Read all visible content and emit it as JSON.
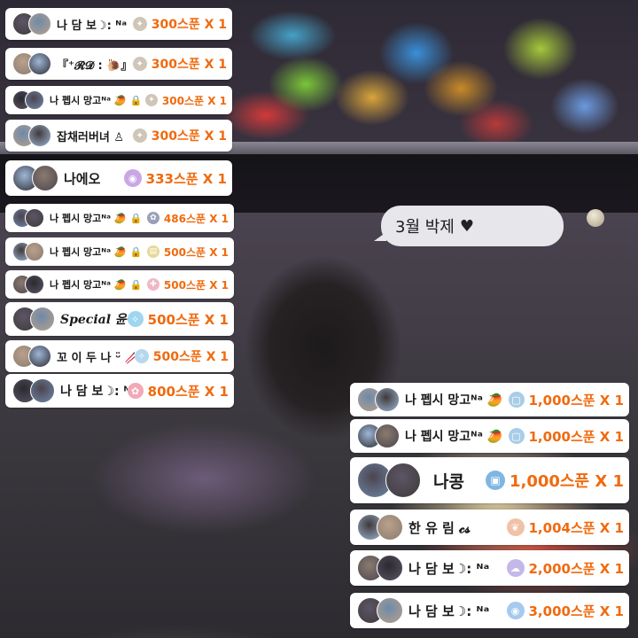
{
  "bubble": {
    "text": "3월 박제",
    "icon": "heart-icon",
    "glyph": "♥"
  },
  "donations": [
    {
      "name": "나 담 보☽: ᴺᵃ",
      "gift_icon": "candle-icon",
      "gift_glyph": "✦",
      "gift_color": "#cfc6b8",
      "amount": "300스푼 X 1"
    },
    {
      "name": "『⁺𝓡𝓓 : 🐌』",
      "gift_icon": "candle-icon",
      "gift_glyph": "✦",
      "gift_color": "#cfc6b8",
      "amount": "300스푼 X 1"
    },
    {
      "name": "나 펩시 망고ᴺᵃ 🥭 🔒",
      "gift_icon": "candle-icon",
      "gift_glyph": "✦",
      "gift_color": "#cfc6b8",
      "amount": "300스푼 X 1"
    },
    {
      "name": "잡채러버녀 ♙",
      "gift_icon": "candle-icon",
      "gift_glyph": "✦",
      "gift_color": "#cfc6b8",
      "amount": "300스푼 X 1"
    },
    {
      "name": "나에오",
      "gift_icon": "disc-icon",
      "gift_glyph": "◉",
      "gift_color": "#c9a6e6",
      "amount": "333스푼 X 1"
    },
    {
      "name": "나 펩시 망고ᴺᵃ 🥭 🔒",
      "gift_icon": "bell-icon",
      "gift_glyph": "✿",
      "gift_color": "#9aa0b8",
      "amount": "486스푼 X 1"
    },
    {
      "name": "나 펩시 망고ᴺᵃ 🥭 🔒",
      "gift_icon": "ticket-icon",
      "gift_glyph": "▤",
      "gift_color": "#e7d89a",
      "amount": "500스푼 X 1"
    },
    {
      "name": "나 펩시 망고ᴺᵃ 🥭 🔒",
      "gift_icon": "figure-icon",
      "gift_glyph": "✚",
      "gift_color": "#f0b8c6",
      "amount": "500스푼 X 1"
    },
    {
      "name": "Special 윤건",
      "gift_icon": "sparkle-icon",
      "gift_glyph": "✧",
      "gift_color": "#9dd6ee",
      "amount": "500스푼 X 1"
    },
    {
      "name": "꼬 이 두 나 ᵕ̈ 🥢",
      "gift_icon": "sparkle-icon",
      "gift_glyph": "✧",
      "gift_color": "#b5d8ee",
      "amount": "500스푼 X 1"
    },
    {
      "name": "나 담 보☽: ᴺᵃ",
      "gift_icon": "bow-icon",
      "gift_glyph": "✿",
      "gift_color": "#f3a7b7",
      "amount": "800스푼 X 1"
    },
    {
      "name": "나 펩시 망고ᴺᵃ 🥭 🔒",
      "gift_icon": "frame-icon",
      "gift_glyph": "▢",
      "gift_color": "#a9cde8",
      "amount": "1,000스푼 X 1"
    },
    {
      "name": "나 펩시 망고ᴺᵃ 🥭 🔒",
      "gift_icon": "frame-icon",
      "gift_glyph": "▢",
      "gift_color": "#a9cde8",
      "amount": "1,000스푼 X 1"
    },
    {
      "name": "나콩",
      "gift_icon": "frame-icon",
      "gift_glyph": "▣",
      "gift_color": "#7fb6e2",
      "amount": "1,000스푼 X 1"
    },
    {
      "name": "한 유 림           𝓬𝓼",
      "gift_icon": "wings-icon",
      "gift_glyph": "❦",
      "gift_color": "#f0c2a8",
      "amount": "1,004스푼 X 1"
    },
    {
      "name": "나 담 보☽: ᴺᵃ",
      "gift_icon": "cloud-icon",
      "gift_glyph": "☁",
      "gift_color": "#c4b8e8",
      "amount": "2,000스푼 X 1"
    },
    {
      "name": "나 담 보☽: ᴺᵃ",
      "gift_icon": "disc-icon",
      "gift_glyph": "◉",
      "gift_color": "#a6c9ee",
      "amount": "3,000스푼 X 1"
    }
  ],
  "avatar_colors": [
    "#3f3a3a",
    "#8a7b6e",
    "#5c5566",
    "#b9a08c",
    "#2a2a30",
    "#6e8aa8",
    "#9fb6d6",
    "#4c4450"
  ]
}
